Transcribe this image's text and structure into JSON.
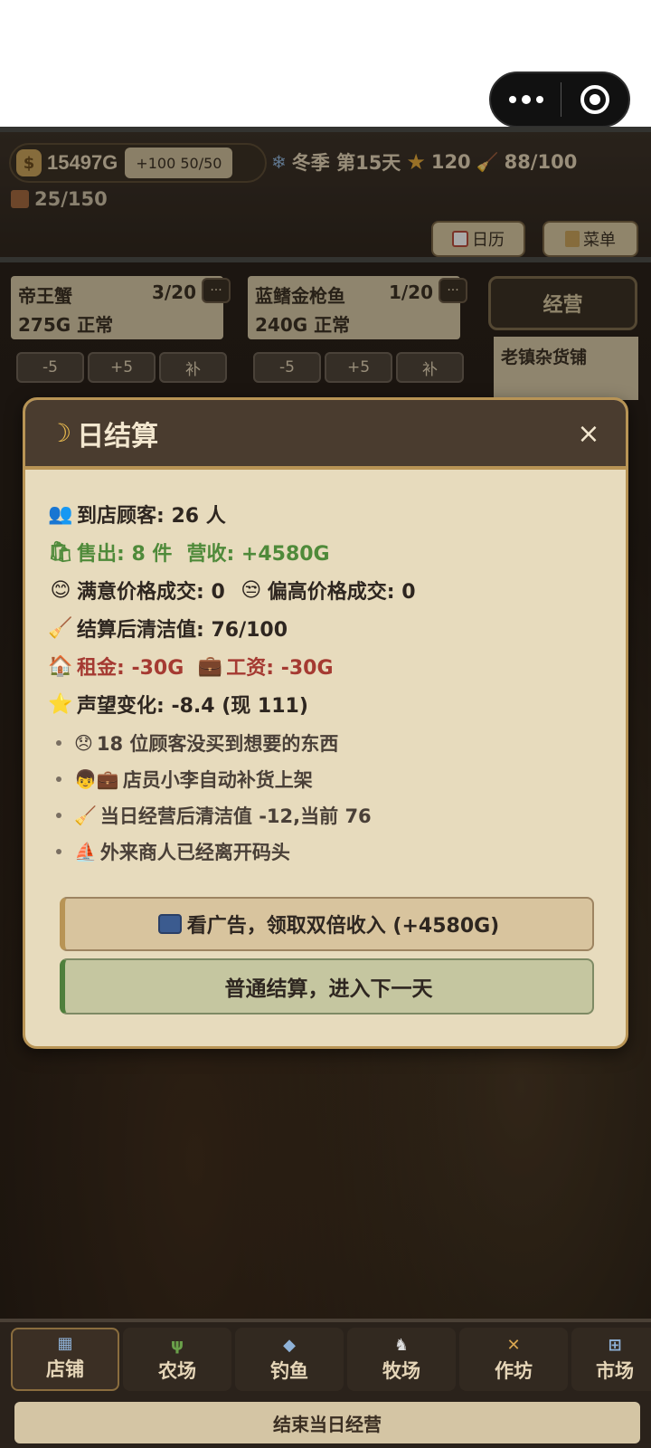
{
  "header": {
    "gold": "15497G",
    "energy_chip": "+100 50/50",
    "season_day": "冬季 第15天",
    "reputation": "120",
    "cleanliness": "88/100",
    "stock": "25/150",
    "calendar_label": "日历",
    "menu_label": "菜单"
  },
  "shelves": [
    {
      "name": "帝王蟹",
      "count": "3/20",
      "price": "275G 正常"
    },
    {
      "name": "蓝鳍金枪鱼",
      "count": "1/20",
      "price": "240G 正常"
    }
  ],
  "shelf_buttons": {
    "minus": "-5",
    "plus": "+5",
    "refill": "补"
  },
  "side": {
    "ops_label": "经营",
    "shop_name": "老镇杂货铺"
  },
  "modal": {
    "title": "日结算",
    "close": "×",
    "customers": "到店顾客: 26 人",
    "sold": "售出: 8 件",
    "revenue": "营收: +4580G",
    "satisfied": "满意价格成交: 0",
    "high_price": "偏高价格成交: 0",
    "clean_after": "结算后清洁值: 76/100",
    "rent": "租金: -30G",
    "wage": "工资: -30G",
    "reputation_change": "声望变化: -8.4 (现 111)",
    "notes": [
      "18 位顾客没买到想要的东西",
      "店员小李自动补货上架",
      "当日经营后清洁值 -12,当前 76",
      "外来商人已经离开码头"
    ],
    "ad_button": "看广告，领取双倍收入 (+4580G)",
    "normal_button": "普通结算，进入下一天"
  },
  "nav": {
    "tabs": [
      "店铺",
      "农场",
      "钓鱼",
      "牧场",
      "作坊",
      "市场"
    ],
    "end_day": "结束当日经营"
  }
}
